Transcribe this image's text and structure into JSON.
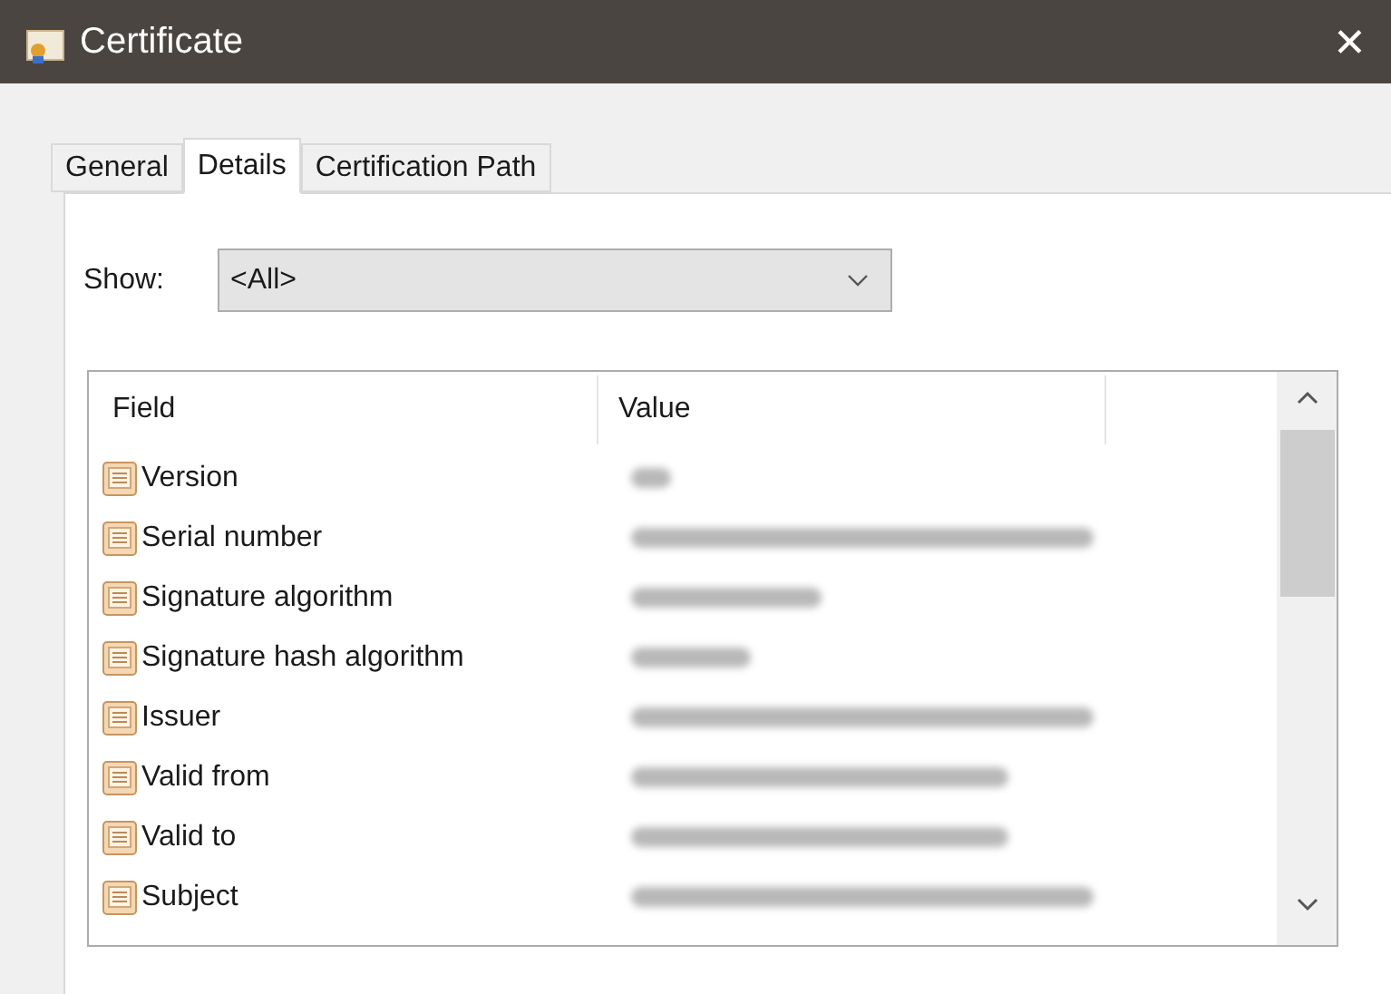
{
  "window": {
    "title": "Certificate",
    "close_label": "✕"
  },
  "tabs": [
    {
      "label": "General",
      "selected": false
    },
    {
      "label": "Details",
      "selected": true
    },
    {
      "label": "Certification Path",
      "selected": false
    }
  ],
  "show": {
    "label": "Show:",
    "value": "<All>"
  },
  "table": {
    "columns": [
      "Field",
      "Value"
    ],
    "rows": [
      {
        "field": "Version",
        "kind": "short"
      },
      {
        "field": "Serial number",
        "kind": "long"
      },
      {
        "field": "Signature algorithm",
        "kind": "medium"
      },
      {
        "field": "Signature hash algorithm",
        "kind": "small"
      },
      {
        "field": "Issuer",
        "kind": "long"
      },
      {
        "field": "Valid from",
        "kind": "wide"
      },
      {
        "field": "Valid to",
        "kind": "wide"
      },
      {
        "field": "Subject",
        "kind": "long"
      }
    ]
  }
}
